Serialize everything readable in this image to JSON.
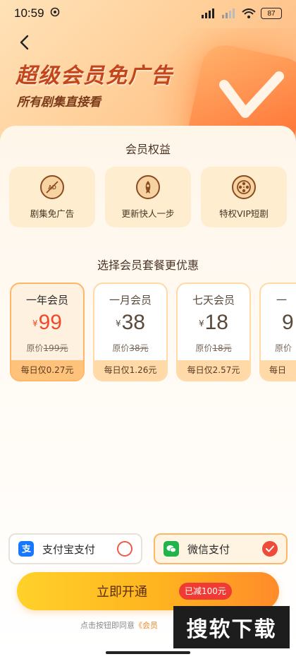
{
  "status_bar": {
    "time": "10:59",
    "battery": "87"
  },
  "hero": {
    "title": "超级会员免广告",
    "subtitle": "所有剧集直接看"
  },
  "benefits": {
    "title": "会员权益",
    "items": [
      {
        "label": "剧集免广告",
        "icon": "no-ad-icon"
      },
      {
        "label": "更新快人一步",
        "icon": "rocket-icon"
      },
      {
        "label": "特权VIP短剧",
        "icon": "film-reel-icon"
      }
    ]
  },
  "plans": {
    "title": "选择会员套餐更优惠",
    "currency": "¥",
    "orig_prefix": "原价",
    "items": [
      {
        "name": "一年会员",
        "price": "99",
        "orig": "199元",
        "daily": "每日仅0.27元",
        "selected": true
      },
      {
        "name": "一月会员",
        "price": "38",
        "orig": "38元",
        "daily": "每日仅1.26元",
        "selected": false
      },
      {
        "name": "七天会员",
        "price": "18",
        "orig": "18元",
        "daily": "每日仅2.57元",
        "selected": false
      },
      {
        "name": "一",
        "price": "9",
        "orig": "",
        "daily": "每日",
        "selected": false
      }
    ]
  },
  "payment": {
    "options": [
      {
        "label": "支付宝支付",
        "icon": "alipay-icon",
        "selected": false
      },
      {
        "label": "微信支付",
        "icon": "wechat-pay-icon",
        "selected": true
      }
    ]
  },
  "cta": {
    "label": "立即开通",
    "badge": "已减100元"
  },
  "agreement": {
    "text": "点击按钮即同意",
    "link": "《会员"
  },
  "watermark": {
    "text": "搜软下载"
  },
  "colors": {
    "accent": "#ee4b3a",
    "brand_orange": "#ffb31f",
    "title_red": "#c2451c"
  }
}
